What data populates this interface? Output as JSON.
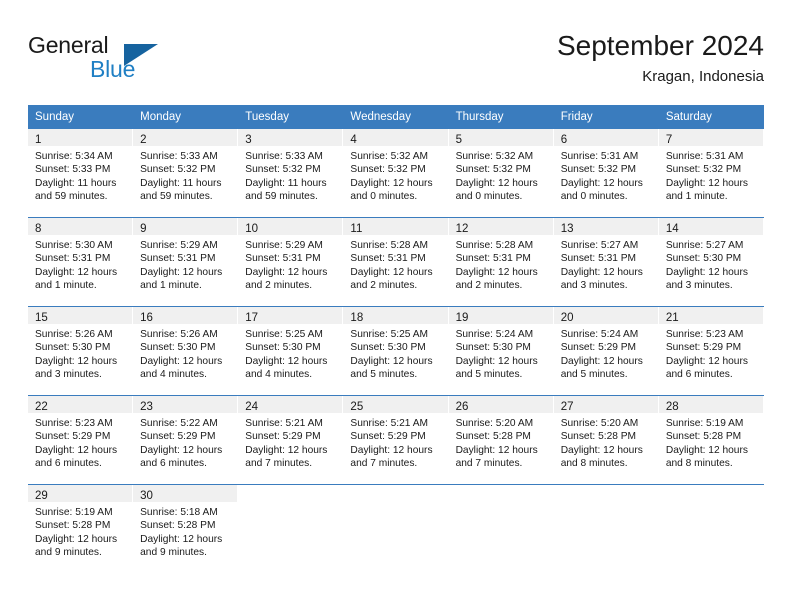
{
  "logo": {
    "word_one": "General",
    "word_two": "Blue",
    "triangle_icon": "blue-triangle-icon",
    "brand_blue": "#1f7fc4",
    "brand_dark_blue": "#16639f"
  },
  "header": {
    "title": "September 2024",
    "location": "Kragan, Indonesia"
  },
  "colors": {
    "header_row_bg": "#3a7cbe",
    "daynum_bg": "#f0f0f0",
    "text": "#1a1a1a"
  },
  "weekdays": [
    "Sunday",
    "Monday",
    "Tuesday",
    "Wednesday",
    "Thursday",
    "Friday",
    "Saturday"
  ],
  "weeks": [
    [
      {
        "day": "1",
        "sunrise": "Sunrise: 5:34 AM",
        "sunset": "Sunset: 5:33 PM",
        "daylight1": "Daylight: 11 hours",
        "daylight2": "and 59 minutes."
      },
      {
        "day": "2",
        "sunrise": "Sunrise: 5:33 AM",
        "sunset": "Sunset: 5:32 PM",
        "daylight1": "Daylight: 11 hours",
        "daylight2": "and 59 minutes."
      },
      {
        "day": "3",
        "sunrise": "Sunrise: 5:33 AM",
        "sunset": "Sunset: 5:32 PM",
        "daylight1": "Daylight: 11 hours",
        "daylight2": "and 59 minutes."
      },
      {
        "day": "4",
        "sunrise": "Sunrise: 5:32 AM",
        "sunset": "Sunset: 5:32 PM",
        "daylight1": "Daylight: 12 hours",
        "daylight2": "and 0 minutes."
      },
      {
        "day": "5",
        "sunrise": "Sunrise: 5:32 AM",
        "sunset": "Sunset: 5:32 PM",
        "daylight1": "Daylight: 12 hours",
        "daylight2": "and 0 minutes."
      },
      {
        "day": "6",
        "sunrise": "Sunrise: 5:31 AM",
        "sunset": "Sunset: 5:32 PM",
        "daylight1": "Daylight: 12 hours",
        "daylight2": "and 0 minutes."
      },
      {
        "day": "7",
        "sunrise": "Sunrise: 5:31 AM",
        "sunset": "Sunset: 5:32 PM",
        "daylight1": "Daylight: 12 hours",
        "daylight2": "and 1 minute."
      }
    ],
    [
      {
        "day": "8",
        "sunrise": "Sunrise: 5:30 AM",
        "sunset": "Sunset: 5:31 PM",
        "daylight1": "Daylight: 12 hours",
        "daylight2": "and 1 minute."
      },
      {
        "day": "9",
        "sunrise": "Sunrise: 5:29 AM",
        "sunset": "Sunset: 5:31 PM",
        "daylight1": "Daylight: 12 hours",
        "daylight2": "and 1 minute."
      },
      {
        "day": "10",
        "sunrise": "Sunrise: 5:29 AM",
        "sunset": "Sunset: 5:31 PM",
        "daylight1": "Daylight: 12 hours",
        "daylight2": "and 2 minutes."
      },
      {
        "day": "11",
        "sunrise": "Sunrise: 5:28 AM",
        "sunset": "Sunset: 5:31 PM",
        "daylight1": "Daylight: 12 hours",
        "daylight2": "and 2 minutes."
      },
      {
        "day": "12",
        "sunrise": "Sunrise: 5:28 AM",
        "sunset": "Sunset: 5:31 PM",
        "daylight1": "Daylight: 12 hours",
        "daylight2": "and 2 minutes."
      },
      {
        "day": "13",
        "sunrise": "Sunrise: 5:27 AM",
        "sunset": "Sunset: 5:31 PM",
        "daylight1": "Daylight: 12 hours",
        "daylight2": "and 3 minutes."
      },
      {
        "day": "14",
        "sunrise": "Sunrise: 5:27 AM",
        "sunset": "Sunset: 5:30 PM",
        "daylight1": "Daylight: 12 hours",
        "daylight2": "and 3 minutes."
      }
    ],
    [
      {
        "day": "15",
        "sunrise": "Sunrise: 5:26 AM",
        "sunset": "Sunset: 5:30 PM",
        "daylight1": "Daylight: 12 hours",
        "daylight2": "and 3 minutes."
      },
      {
        "day": "16",
        "sunrise": "Sunrise: 5:26 AM",
        "sunset": "Sunset: 5:30 PM",
        "daylight1": "Daylight: 12 hours",
        "daylight2": "and 4 minutes."
      },
      {
        "day": "17",
        "sunrise": "Sunrise: 5:25 AM",
        "sunset": "Sunset: 5:30 PM",
        "daylight1": "Daylight: 12 hours",
        "daylight2": "and 4 minutes."
      },
      {
        "day": "18",
        "sunrise": "Sunrise: 5:25 AM",
        "sunset": "Sunset: 5:30 PM",
        "daylight1": "Daylight: 12 hours",
        "daylight2": "and 5 minutes."
      },
      {
        "day": "19",
        "sunrise": "Sunrise: 5:24 AM",
        "sunset": "Sunset: 5:30 PM",
        "daylight1": "Daylight: 12 hours",
        "daylight2": "and 5 minutes."
      },
      {
        "day": "20",
        "sunrise": "Sunrise: 5:24 AM",
        "sunset": "Sunset: 5:29 PM",
        "daylight1": "Daylight: 12 hours",
        "daylight2": "and 5 minutes."
      },
      {
        "day": "21",
        "sunrise": "Sunrise: 5:23 AM",
        "sunset": "Sunset: 5:29 PM",
        "daylight1": "Daylight: 12 hours",
        "daylight2": "and 6 minutes."
      }
    ],
    [
      {
        "day": "22",
        "sunrise": "Sunrise: 5:23 AM",
        "sunset": "Sunset: 5:29 PM",
        "daylight1": "Daylight: 12 hours",
        "daylight2": "and 6 minutes."
      },
      {
        "day": "23",
        "sunrise": "Sunrise: 5:22 AM",
        "sunset": "Sunset: 5:29 PM",
        "daylight1": "Daylight: 12 hours",
        "daylight2": "and 6 minutes."
      },
      {
        "day": "24",
        "sunrise": "Sunrise: 5:21 AM",
        "sunset": "Sunset: 5:29 PM",
        "daylight1": "Daylight: 12 hours",
        "daylight2": "and 7 minutes."
      },
      {
        "day": "25",
        "sunrise": "Sunrise: 5:21 AM",
        "sunset": "Sunset: 5:29 PM",
        "daylight1": "Daylight: 12 hours",
        "daylight2": "and 7 minutes."
      },
      {
        "day": "26",
        "sunrise": "Sunrise: 5:20 AM",
        "sunset": "Sunset: 5:28 PM",
        "daylight1": "Daylight: 12 hours",
        "daylight2": "and 7 minutes."
      },
      {
        "day": "27",
        "sunrise": "Sunrise: 5:20 AM",
        "sunset": "Sunset: 5:28 PM",
        "daylight1": "Daylight: 12 hours",
        "daylight2": "and 8 minutes."
      },
      {
        "day": "28",
        "sunrise": "Sunrise: 5:19 AM",
        "sunset": "Sunset: 5:28 PM",
        "daylight1": "Daylight: 12 hours",
        "daylight2": "and 8 minutes."
      }
    ],
    [
      {
        "day": "29",
        "sunrise": "Sunrise: 5:19 AM",
        "sunset": "Sunset: 5:28 PM",
        "daylight1": "Daylight: 12 hours",
        "daylight2": "and 9 minutes."
      },
      {
        "day": "30",
        "sunrise": "Sunrise: 5:18 AM",
        "sunset": "Sunset: 5:28 PM",
        "daylight1": "Daylight: 12 hours",
        "daylight2": "and 9 minutes."
      },
      {
        "day": "",
        "sunrise": "",
        "sunset": "",
        "daylight1": "",
        "daylight2": ""
      },
      {
        "day": "",
        "sunrise": "",
        "sunset": "",
        "daylight1": "",
        "daylight2": ""
      },
      {
        "day": "",
        "sunrise": "",
        "sunset": "",
        "daylight1": "",
        "daylight2": ""
      },
      {
        "day": "",
        "sunrise": "",
        "sunset": "",
        "daylight1": "",
        "daylight2": ""
      },
      {
        "day": "",
        "sunrise": "",
        "sunset": "",
        "daylight1": "",
        "daylight2": ""
      }
    ]
  ]
}
